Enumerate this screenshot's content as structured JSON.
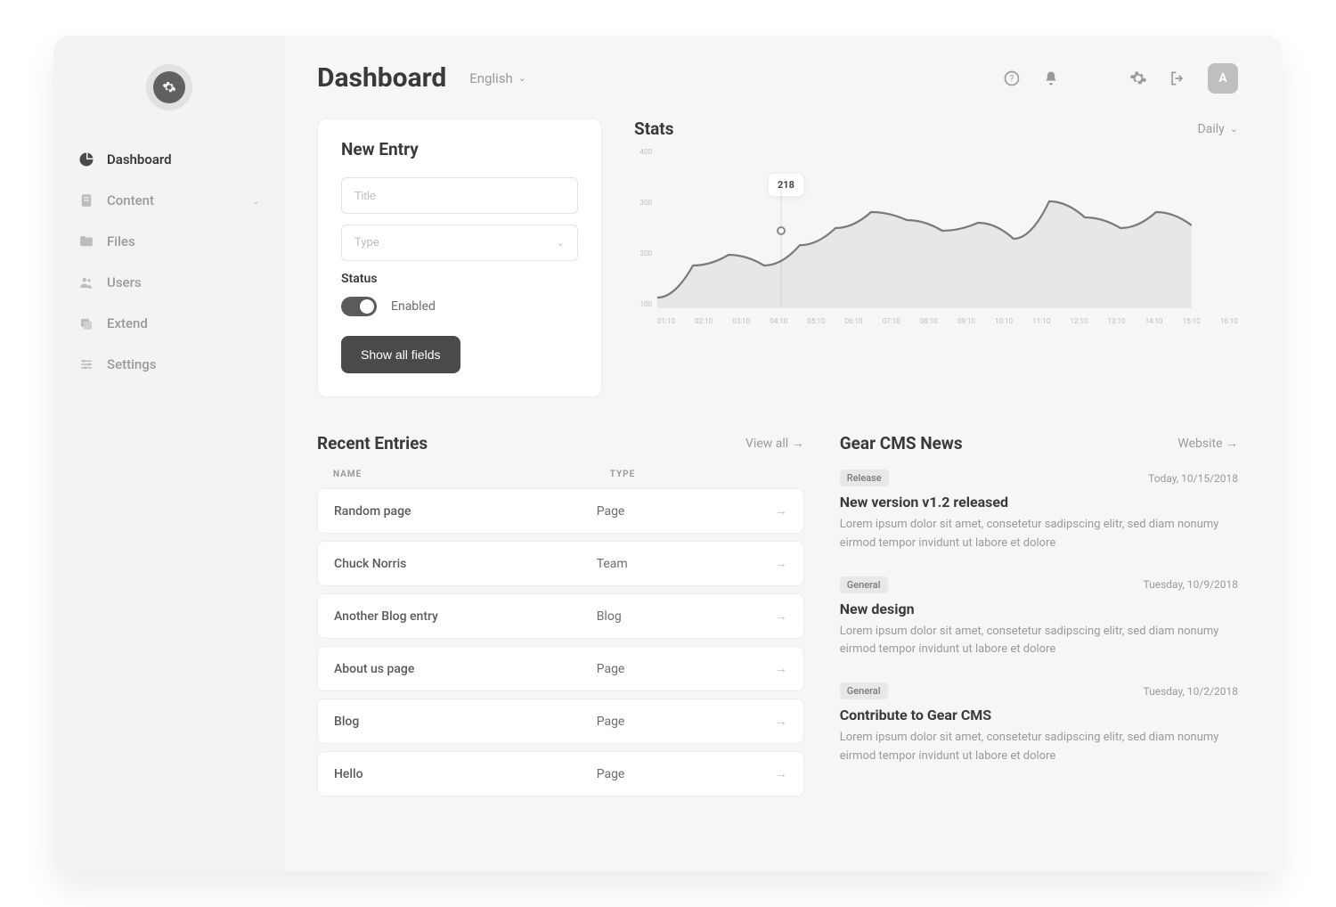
{
  "header": {
    "title": "Dashboard",
    "language": "English",
    "avatar_initial": "A"
  },
  "sidebar": {
    "items": [
      {
        "label": "Dashboard",
        "icon": "pie-chart-icon",
        "active": true
      },
      {
        "label": "Content",
        "icon": "document-icon",
        "expandable": true
      },
      {
        "label": "Files",
        "icon": "folder-icon"
      },
      {
        "label": "Users",
        "icon": "users-icon"
      },
      {
        "label": "Extend",
        "icon": "layers-icon"
      },
      {
        "label": "Settings",
        "icon": "sliders-icon"
      }
    ]
  },
  "new_entry": {
    "heading": "New Entry",
    "title_placeholder": "Title",
    "type_placeholder": "Type",
    "status_label": "Status",
    "status_value": "Enabled",
    "button": "Show all fields"
  },
  "stats": {
    "heading": "Stats",
    "range_label": "Daily",
    "tooltip_value": "218"
  },
  "chart_data": {
    "type": "area",
    "ylabel": "",
    "xlabel": "",
    "ylim": [
      100,
      400
    ],
    "categories": [
      "01:10",
      "02:10",
      "03:10",
      "04:10",
      "05:10",
      "06:10",
      "07:10",
      "08:10",
      "09:10",
      "10:10",
      "11:10",
      "12:10",
      "13:10",
      "14:10",
      "15:10",
      "16:10"
    ],
    "values": [
      120,
      180,
      200,
      180,
      218,
      250,
      280,
      265,
      245,
      260,
      230,
      300,
      270,
      250,
      280,
      255
    ],
    "yticks": [
      400,
      300,
      200,
      100
    ],
    "tooltip": {
      "x": "04:10",
      "value": 218
    }
  },
  "recent": {
    "heading": "Recent Entries",
    "link": "View all",
    "columns": {
      "name": "NAME",
      "type": "TYPE"
    },
    "items": [
      {
        "name": "Random page",
        "type": "Page"
      },
      {
        "name": "Chuck Norris",
        "type": "Team"
      },
      {
        "name": "Another Blog entry",
        "type": "Blog"
      },
      {
        "name": "About us page",
        "type": "Page"
      },
      {
        "name": "Blog",
        "type": "Page"
      },
      {
        "name": "Hello",
        "type": "Page"
      }
    ]
  },
  "news": {
    "heading": "Gear CMS News",
    "link": "Website",
    "items": [
      {
        "tag": "Release",
        "date": "Today, 10/15/2018",
        "title": "New version v1.2 released",
        "body": "Lorem ipsum dolor sit amet, consetetur sadipscing elitr, sed diam nonumy eirmod tempor invidunt ut labore et dolore"
      },
      {
        "tag": "General",
        "date": "Tuesday, 10/9/2018",
        "title": "New design",
        "body": "Lorem ipsum dolor sit amet, consetetur sadipscing elitr, sed diam nonumy eirmod tempor invidunt ut labore et dolore"
      },
      {
        "tag": "General",
        "date": "Tuesday, 10/2/2018",
        "title": "Contribute to Gear CMS",
        "body": "Lorem ipsum dolor sit amet, consetetur sadipscing elitr, sed diam nonumy eirmod tempor invidunt ut labore et dolore"
      }
    ]
  }
}
